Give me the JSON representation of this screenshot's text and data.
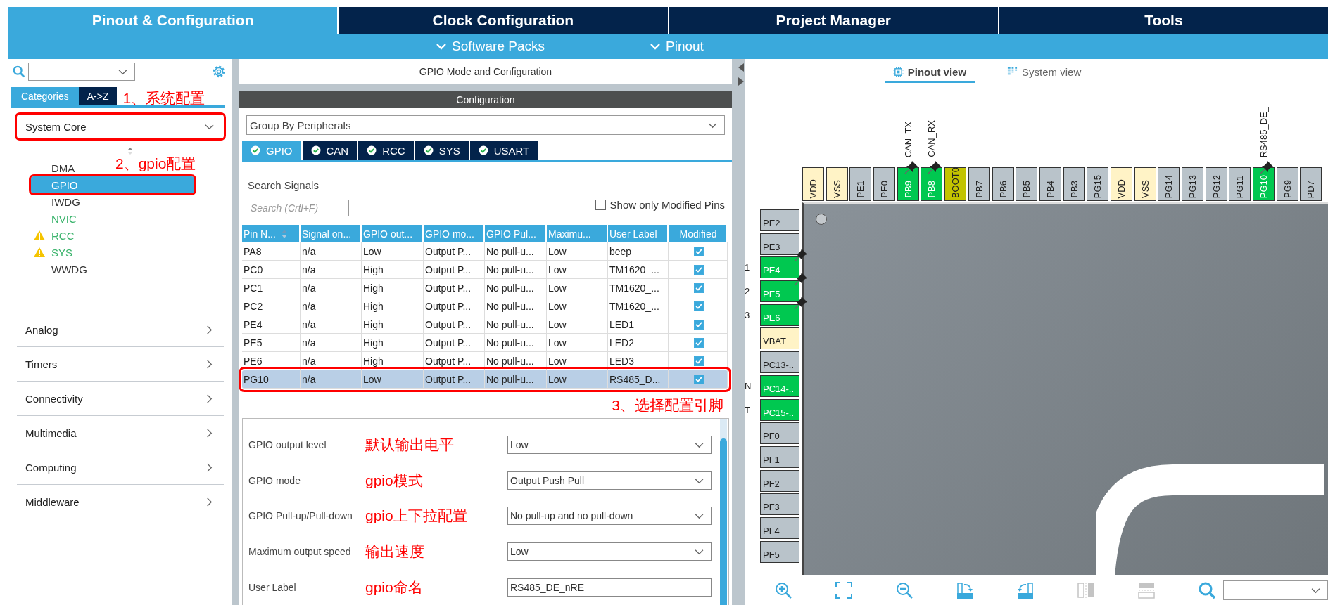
{
  "top_tabs": [
    {
      "label": "Pinout & Configuration",
      "selected": true
    },
    {
      "label": "Clock Configuration",
      "selected": false
    },
    {
      "label": "Project Manager",
      "selected": false
    },
    {
      "label": "Tools",
      "selected": false
    }
  ],
  "sub_menu": [
    {
      "label": "Software Packs"
    },
    {
      "label": "Pinout"
    }
  ],
  "left_panel": {
    "view_tabs": [
      {
        "label": "Categories",
        "selected": true
      },
      {
        "label": "A->Z",
        "selected": false
      }
    ],
    "annotation": "1、系统配置",
    "categories": [
      {
        "label": "System Core",
        "expanded": true,
        "highlighted": true,
        "annotation": "2、gpio配置",
        "items": [
          {
            "label": "DMA",
            "selected": false,
            "highlighted": false,
            "configured": false,
            "warning": false
          },
          {
            "label": "GPIO",
            "selected": true,
            "highlighted": true,
            "configured": false,
            "warning": false
          },
          {
            "label": "IWDG",
            "selected": false,
            "highlighted": false,
            "configured": false,
            "warning": false
          },
          {
            "label": "NVIC",
            "selected": false,
            "highlighted": false,
            "configured": true,
            "warning": false
          },
          {
            "label": "RCC",
            "selected": false,
            "highlighted": false,
            "configured": true,
            "warning": true
          },
          {
            "label": "SYS",
            "selected": false,
            "highlighted": false,
            "configured": true,
            "warning": true
          },
          {
            "label": "WWDG",
            "selected": false,
            "highlighted": false,
            "configured": false,
            "warning": false
          }
        ]
      },
      {
        "label": "Analog",
        "expanded": false,
        "highlighted": false
      },
      {
        "label": "Timers",
        "expanded": false,
        "highlighted": false
      },
      {
        "label": "Connectivity",
        "expanded": false,
        "highlighted": false
      },
      {
        "label": "Multimedia",
        "expanded": false,
        "highlighted": false
      },
      {
        "label": "Computing",
        "expanded": false,
        "highlighted": false
      },
      {
        "label": "Middleware",
        "expanded": false,
        "highlighted": false
      }
    ]
  },
  "config_panel": {
    "title": "GPIO Mode and Configuration",
    "section": "Configuration",
    "group_by": "Group By Peripherals",
    "tabs": [
      {
        "label": "GPIO",
        "selected": true
      },
      {
        "label": "CAN",
        "selected": false
      },
      {
        "label": "RCC",
        "selected": false
      },
      {
        "label": "SYS",
        "selected": false
      },
      {
        "label": "USART",
        "selected": false
      }
    ],
    "search_label": "Search Signals",
    "search": {
      "placeholder": "Search (Crtl+F)"
    },
    "show_modified": {
      "label": "Show only Modified Pins",
      "checked": false
    },
    "table": {
      "columns": [
        {
          "label": "Pin N...",
          "sorted": true
        },
        {
          "label": "Signal on...",
          "sorted": false
        },
        {
          "label": "GPIO out...",
          "sorted": false
        },
        {
          "label": "GPIO mo...",
          "sorted": false
        },
        {
          "label": "GPIO Pul...",
          "sorted": false
        },
        {
          "label": "Maximu...",
          "sorted": false
        },
        {
          "label": "User Label",
          "sorted": false
        },
        {
          "label": "Modified",
          "sorted": false
        }
      ],
      "rows": [
        {
          "cells": [
            "PA8",
            "n/a",
            "Low",
            "Output P...",
            "No pull-u...",
            "Low",
            "beep"
          ],
          "modified": true,
          "selected": false,
          "highlighted": false
        },
        {
          "cells": [
            "PC0",
            "n/a",
            "High",
            "Output P...",
            "No pull-u...",
            "Low",
            "TM1620_..."
          ],
          "modified": true,
          "selected": false,
          "highlighted": false
        },
        {
          "cells": [
            "PC1",
            "n/a",
            "High",
            "Output P...",
            "No pull-u...",
            "Low",
            "TM1620_..."
          ],
          "modified": true,
          "selected": false,
          "highlighted": false
        },
        {
          "cells": [
            "PC2",
            "n/a",
            "High",
            "Output P...",
            "No pull-u...",
            "Low",
            "TM1620_..."
          ],
          "modified": true,
          "selected": false,
          "highlighted": false
        },
        {
          "cells": [
            "PE4",
            "n/a",
            "High",
            "Output P...",
            "No pull-u...",
            "Low",
            "LED1"
          ],
          "modified": true,
          "selected": false,
          "highlighted": false
        },
        {
          "cells": [
            "PE5",
            "n/a",
            "High",
            "Output P...",
            "No pull-u...",
            "Low",
            "LED2"
          ],
          "modified": true,
          "selected": false,
          "highlighted": false
        },
        {
          "cells": [
            "PE6",
            "n/a",
            "High",
            "Output P...",
            "No pull-u...",
            "Low",
            "LED3"
          ],
          "modified": true,
          "selected": false,
          "highlighted": false
        },
        {
          "cells": [
            "PG10",
            "n/a",
            "Low",
            "Output P...",
            "No pull-u...",
            "Low",
            "RS485_D..."
          ],
          "modified": true,
          "selected": true,
          "highlighted": true
        }
      ]
    },
    "annotation": "3、选择配置引脚",
    "form": [
      {
        "kind": "select",
        "label": "GPIO output level",
        "annotation": "默认输出电平",
        "value": "Low"
      },
      {
        "kind": "select",
        "label": "GPIO mode",
        "annotation": "gpio模式",
        "value": "Output Push Pull"
      },
      {
        "kind": "select",
        "label": "GPIO Pull-up/Pull-down",
        "annotation": "gpio上下拉配置",
        "value": "No pull-up and no pull-down"
      },
      {
        "kind": "select",
        "label": "Maximum output speed",
        "annotation": "输出速度",
        "value": "Low"
      },
      {
        "kind": "text",
        "label": "User Label",
        "annotation": "gpio命名",
        "value": "RS485_DE_nRE"
      }
    ]
  },
  "pinout": {
    "view_tabs": [
      {
        "label": "Pinout view",
        "selected": true
      },
      {
        "label": "System view",
        "selected": false
      }
    ],
    "top_pins": [
      {
        "label": "VDD",
        "kind": "power",
        "assigned": false,
        "pinned": false
      },
      {
        "label": "VSS",
        "kind": "power",
        "assigned": false,
        "pinned": false
      },
      {
        "label": "PE1",
        "kind": "io",
        "assigned": false,
        "pinned": false
      },
      {
        "label": "PE0",
        "kind": "io",
        "assigned": false,
        "pinned": false
      },
      {
        "label": "PB9",
        "kind": "io",
        "assigned": true,
        "pinned": true,
        "signal": "CAN_TX"
      },
      {
        "label": "PB8",
        "kind": "io",
        "assigned": true,
        "pinned": true,
        "signal": "CAN_RX"
      },
      {
        "label": "BOOT0",
        "kind": "boot",
        "assigned": false,
        "pinned": false
      },
      {
        "label": "PB7",
        "kind": "io",
        "assigned": false,
        "pinned": false
      },
      {
        "label": "PB6",
        "kind": "io",
        "assigned": false,
        "pinned": false
      },
      {
        "label": "PB5",
        "kind": "io",
        "assigned": false,
        "pinned": false
      },
      {
        "label": "PB4",
        "kind": "io",
        "assigned": false,
        "pinned": false
      },
      {
        "label": "PB3",
        "kind": "io",
        "assigned": false,
        "pinned": false
      },
      {
        "label": "PG15",
        "kind": "io",
        "assigned": false,
        "pinned": false
      },
      {
        "label": "VDD",
        "kind": "power",
        "assigned": false,
        "pinned": false
      },
      {
        "label": "VSS",
        "kind": "power",
        "assigned": false,
        "pinned": false
      },
      {
        "label": "PG14",
        "kind": "io",
        "assigned": false,
        "pinned": false
      },
      {
        "label": "PG13",
        "kind": "io",
        "assigned": false,
        "pinned": false
      },
      {
        "label": "PG12",
        "kind": "io",
        "assigned": false,
        "pinned": false
      },
      {
        "label": "PG11",
        "kind": "io",
        "assigned": false,
        "pinned": false
      },
      {
        "label": "PG10",
        "kind": "io",
        "assigned": true,
        "pinned": true,
        "signal": "RS485_DE_"
      },
      {
        "label": "PG9",
        "kind": "io",
        "assigned": false,
        "pinned": false
      },
      {
        "label": "PD7",
        "kind": "io",
        "assigned": false,
        "pinned": false
      }
    ],
    "left_pins": [
      {
        "label": "PE2",
        "kind": "io",
        "assigned": false,
        "pinned": false
      },
      {
        "label": "PE3",
        "kind": "io",
        "assigned": false,
        "pinned": false
      },
      {
        "label": "PE4",
        "kind": "io",
        "assigned": true,
        "pinned": true,
        "signal": "1"
      },
      {
        "label": "PE5",
        "kind": "io",
        "assigned": true,
        "pinned": true,
        "signal": "2"
      },
      {
        "label": "PE6",
        "kind": "io",
        "assigned": true,
        "pinned": true,
        "signal": "3"
      },
      {
        "label": "VBAT",
        "kind": "power",
        "assigned": false,
        "pinned": false
      },
      {
        "label": "PC13-..",
        "kind": "io",
        "assigned": false,
        "pinned": false
      },
      {
        "label": "PC14-..",
        "kind": "io",
        "assigned": true,
        "pinned": false,
        "signal": "N"
      },
      {
        "label": "PC15-..",
        "kind": "io",
        "assigned": true,
        "pinned": false,
        "signal": "T"
      },
      {
        "label": "PF0",
        "kind": "io",
        "assigned": false,
        "pinned": false
      },
      {
        "label": "PF1",
        "kind": "io",
        "assigned": false,
        "pinned": false
      },
      {
        "label": "PF2",
        "kind": "io",
        "assigned": false,
        "pinned": false
      },
      {
        "label": "PF3",
        "kind": "io",
        "assigned": false,
        "pinned": false
      },
      {
        "label": "PF4",
        "kind": "io",
        "assigned": false,
        "pinned": false
      },
      {
        "label": "PF5",
        "kind": "io",
        "assigned": false,
        "pinned": false
      }
    ],
    "toolbar": [
      {
        "kind": "zoom-in",
        "disabled": false
      },
      {
        "kind": "fit",
        "disabled": false
      },
      {
        "kind": "zoom-out",
        "disabled": false
      },
      {
        "kind": "rotate-right",
        "disabled": false
      },
      {
        "kind": "rotate-left",
        "disabled": false
      },
      {
        "kind": "split-vertical",
        "disabled": true
      },
      {
        "kind": "split-horizontal",
        "disabled": true
      },
      {
        "kind": "search",
        "disabled": false
      }
    ]
  }
}
